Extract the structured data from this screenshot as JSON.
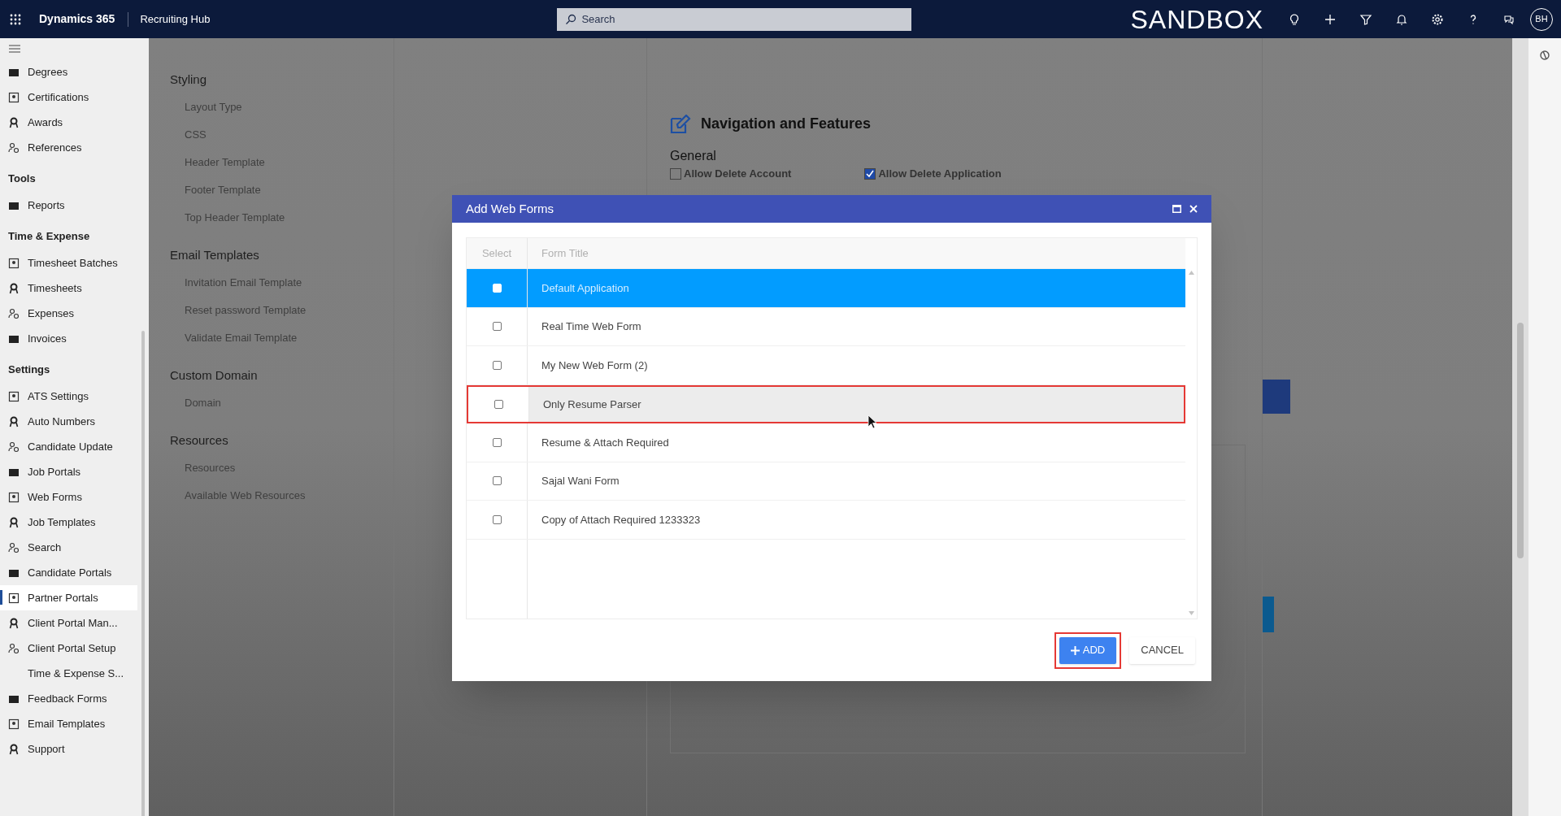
{
  "top_bar": {
    "app_name": "Dynamics 365",
    "area_name": "Recruiting Hub",
    "search_placeholder": "Search",
    "environment_label": "SANDBOX",
    "avatar_initials": "BH"
  },
  "sidebar": {
    "sections": [
      {
        "items": [
          {
            "label": "Degrees",
            "selected": false
          },
          {
            "label": "Certifications",
            "selected": false
          },
          {
            "label": "Awards",
            "selected": false
          },
          {
            "label": "References",
            "selected": false
          }
        ]
      },
      {
        "title": "Tools",
        "items": [
          {
            "label": "Reports",
            "selected": false
          }
        ]
      },
      {
        "title": "Time & Expense",
        "items": [
          {
            "label": "Timesheet Batches",
            "selected": false
          },
          {
            "label": "Timesheets",
            "selected": false
          },
          {
            "label": "Expenses",
            "selected": false
          },
          {
            "label": "Invoices",
            "selected": false
          }
        ]
      },
      {
        "title": "Settings",
        "items": [
          {
            "label": "ATS Settings",
            "selected": false
          },
          {
            "label": "Auto Numbers",
            "selected": false
          },
          {
            "label": "Candidate Update",
            "selected": false
          },
          {
            "label": "Job Portals",
            "selected": false
          },
          {
            "label": "Web Forms",
            "selected": false
          },
          {
            "label": "Job Templates",
            "selected": false
          },
          {
            "label": "Search",
            "selected": false
          },
          {
            "label": "Candidate Portals",
            "selected": false
          },
          {
            "label": "Partner Portals",
            "selected": true
          },
          {
            "label": "Client Portal Man...",
            "selected": false
          },
          {
            "label": "Client Portal Setup",
            "selected": false
          },
          {
            "label": "Time & Expense S...",
            "selected": false
          },
          {
            "label": "Feedback Forms",
            "selected": false
          },
          {
            "label": "Email Templates",
            "selected": false
          },
          {
            "label": "Support",
            "selected": false
          }
        ]
      }
    ]
  },
  "settings_nav": [
    {
      "title": "Styling",
      "items": [
        "Layout Type",
        "CSS",
        "Header Template",
        "Footer Template",
        "Top Header Template"
      ]
    },
    {
      "title": "Email Templates",
      "items": [
        "Invitation Email Template",
        "Reset password Template",
        "Validate Email Template"
      ]
    },
    {
      "title": "Custom Domain",
      "items": [
        "Domain"
      ]
    },
    {
      "title": "Resources",
      "items": [
        "Resources",
        "Available Web Resources"
      ]
    }
  ],
  "panel": {
    "heading": "Navigation and Features",
    "group": "General",
    "options": [
      {
        "label": "Allow Delete Account",
        "checked": false
      },
      {
        "label": "Allow Delete Application",
        "checked": true
      }
    ]
  },
  "dialog": {
    "title": "Add Web Forms",
    "columns": [
      "Select",
      "Form Title"
    ],
    "rows": [
      {
        "title": "Default Application",
        "selected": true,
        "checked": false,
        "highlighted": false
      },
      {
        "title": "Real Time Web Form",
        "selected": false,
        "checked": false,
        "highlighted": false
      },
      {
        "title": "My New Web Form (2)",
        "selected": false,
        "checked": false,
        "highlighted": false
      },
      {
        "title": "Only Resume Parser",
        "selected": false,
        "checked": false,
        "highlighted": true
      },
      {
        "title": "Resume & Attach Required",
        "selected": false,
        "checked": false,
        "highlighted": false
      },
      {
        "title": "Sajal Wani Form",
        "selected": false,
        "checked": false,
        "highlighted": false
      },
      {
        "title": "Copy of Attach Required 1233323",
        "selected": false,
        "checked": false,
        "highlighted": false
      }
    ],
    "add_button": {
      "label": "ADD",
      "highlighted": true
    },
    "cancel_button": {
      "label": "CANCEL"
    }
  }
}
